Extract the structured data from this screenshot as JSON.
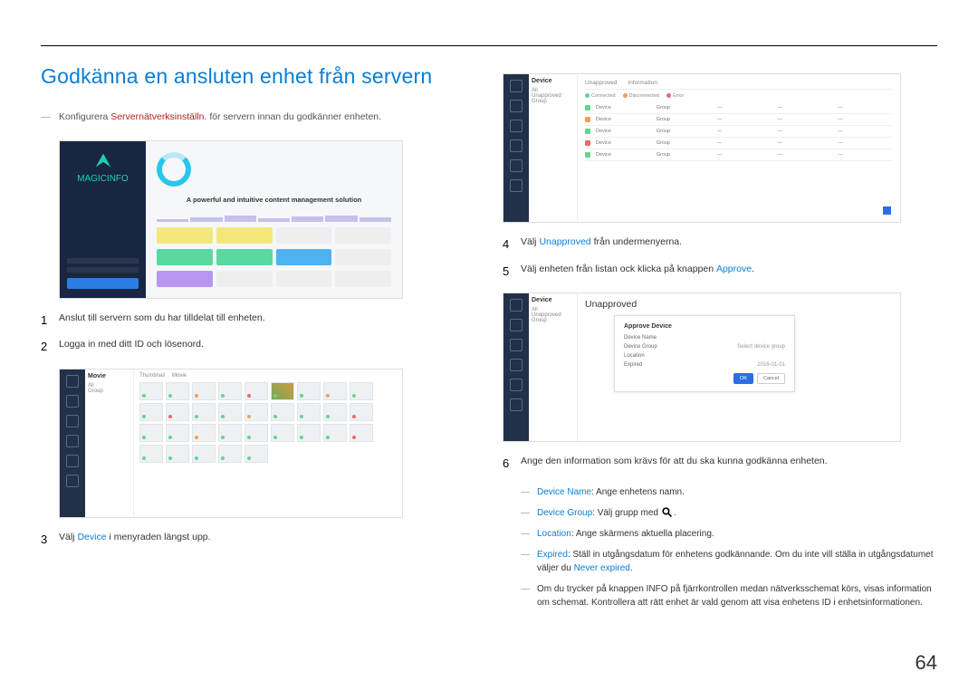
{
  "title": "Godkänna en ansluten enhet från servern",
  "intro_before": "Konfigurera ",
  "intro_link": "Servernätverksinställn.",
  "intro_after": " för servern innan du godkänner enheten.",
  "steps_left": [
    {
      "n": "1",
      "t": "Anslut till servern som du har tilldelat till enheten."
    },
    {
      "n": "2",
      "t": "Logga in med ditt ID och lösenord."
    },
    {
      "n": "3",
      "t_before": "Välj ",
      "t_link": "Device",
      "t_after": " i menyraden längst upp."
    }
  ],
  "steps_right": [
    {
      "n": "4",
      "t_before": "Välj ",
      "t_link": "Unapproved",
      "t_after": " från undermenyerna."
    },
    {
      "n": "5",
      "t_before": "Välj enheten från listan ock klicka på knappen ",
      "t_link": "Approve",
      "t_after": "."
    },
    {
      "n": "6",
      "t": "Ange den information som krävs för att du ska kunna godkänna enheten."
    }
  ],
  "sub6": [
    {
      "label": "Device Name",
      "text": ": Ange enhetens namn."
    },
    {
      "label": "Device Group",
      "text": ": Välj grupp med ",
      "icon": "search"
    },
    {
      "label": "Location",
      "text": ": Ange skärmens aktuella placering."
    },
    {
      "label": "Expired",
      "text": ": Ställ in utgångsdatum för enhetens godkännande. Om du inte vill ställa in utgångsdatumet väljer du ",
      "link": "Never expired",
      "tail": "."
    },
    {
      "plain": "Om du trycker på knappen INFO på fjärrkontrollen medan nätverksschemat körs, visas information om schemat. Kontrollera att rätt enhet är vald genom att visa enhetens ID i enhetsinformationen."
    }
  ],
  "shot_login": {
    "logo": "MAGICINFO",
    "tagline": "A powerful and intuitive content management solution"
  },
  "shot_grid": {
    "side_title": "Movie",
    "tabs": [
      "Thumbnail",
      "Movie"
    ]
  },
  "shot_device": {
    "side_title": "Device",
    "side_items": [
      "All",
      "Unapproved",
      "Group"
    ],
    "tabs": [
      "Unapproved",
      "Information"
    ],
    "status": [
      "Connected",
      "Disconnected",
      "Error"
    ]
  },
  "shot_approve": {
    "side_title": "Device",
    "side_items": [
      "All",
      "Unapproved",
      "Group"
    ],
    "dialog_title": "Approve Device",
    "fields": [
      {
        "k": "Device Name",
        "v": ""
      },
      {
        "k": "Device Group",
        "v": "Select device group"
      },
      {
        "k": "Location",
        "v": ""
      },
      {
        "k": "Expired",
        "v": "2016-01-01"
      }
    ],
    "btn_ok": "OK",
    "btn_cancel": "Cancel"
  },
  "page_num": "64"
}
